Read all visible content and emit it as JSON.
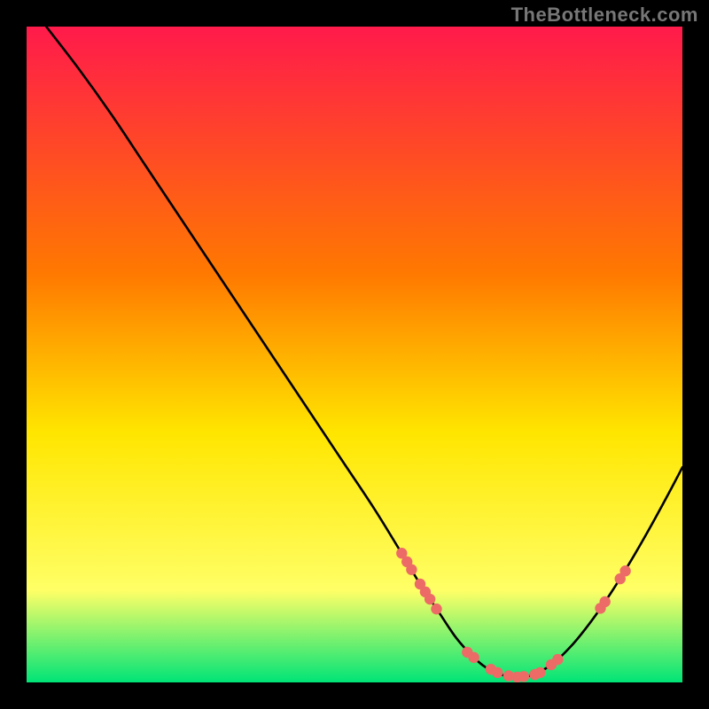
{
  "watermark": "TheBottleneck.com",
  "colors": {
    "curve": "#000000",
    "marker": "#ec6b66",
    "gradient_top": "#ff1a4b",
    "gradient_mid_upper": "#ff7a00",
    "gradient_mid": "#ffe600",
    "gradient_mid_lower": "#ffff66",
    "gradient_bottom": "#00e477"
  },
  "chart_data": {
    "type": "line",
    "title": "",
    "xlabel": "",
    "ylabel": "",
    "xlim": [
      0,
      100
    ],
    "ylim": [
      0,
      100
    ],
    "x": [
      3,
      8,
      13,
      18,
      23,
      28,
      33,
      38,
      43,
      48,
      53,
      57,
      60,
      63,
      65.5,
      68,
      70,
      72,
      74.5,
      77,
      80,
      83,
      86,
      89,
      92,
      95,
      98,
      100
    ],
    "y": [
      100,
      93.5,
      86.5,
      79,
      71.5,
      64,
      56.5,
      49,
      41.5,
      34,
      26.5,
      20,
      15,
      10.5,
      6.8,
      4,
      2.3,
      1.3,
      0.8,
      1.1,
      2.7,
      5.5,
      9.2,
      13.5,
      18.3,
      23.5,
      29,
      32.8
    ],
    "markers": [
      {
        "x": 57.2,
        "y": 19.7
      },
      {
        "x": 58.0,
        "y": 18.4
      },
      {
        "x": 58.7,
        "y": 17.2
      },
      {
        "x": 60.0,
        "y": 15.0
      },
      {
        "x": 60.8,
        "y": 13.8
      },
      {
        "x": 61.5,
        "y": 12.7
      },
      {
        "x": 62.5,
        "y": 11.2
      },
      {
        "x": 67.2,
        "y": 4.6
      },
      {
        "x": 68.2,
        "y": 3.8
      },
      {
        "x": 70.8,
        "y": 2.0
      },
      {
        "x": 71.8,
        "y": 1.5
      },
      {
        "x": 73.5,
        "y": 1.0
      },
      {
        "x": 74.8,
        "y": 0.8
      },
      {
        "x": 75.8,
        "y": 0.9
      },
      {
        "x": 77.5,
        "y": 1.2
      },
      {
        "x": 78.3,
        "y": 1.5
      },
      {
        "x": 80.0,
        "y": 2.7
      },
      {
        "x": 81.0,
        "y": 3.5
      },
      {
        "x": 87.5,
        "y": 11.3
      },
      {
        "x": 88.2,
        "y": 12.3
      },
      {
        "x": 90.5,
        "y": 15.8
      },
      {
        "x": 91.3,
        "y": 17.0
      }
    ]
  }
}
